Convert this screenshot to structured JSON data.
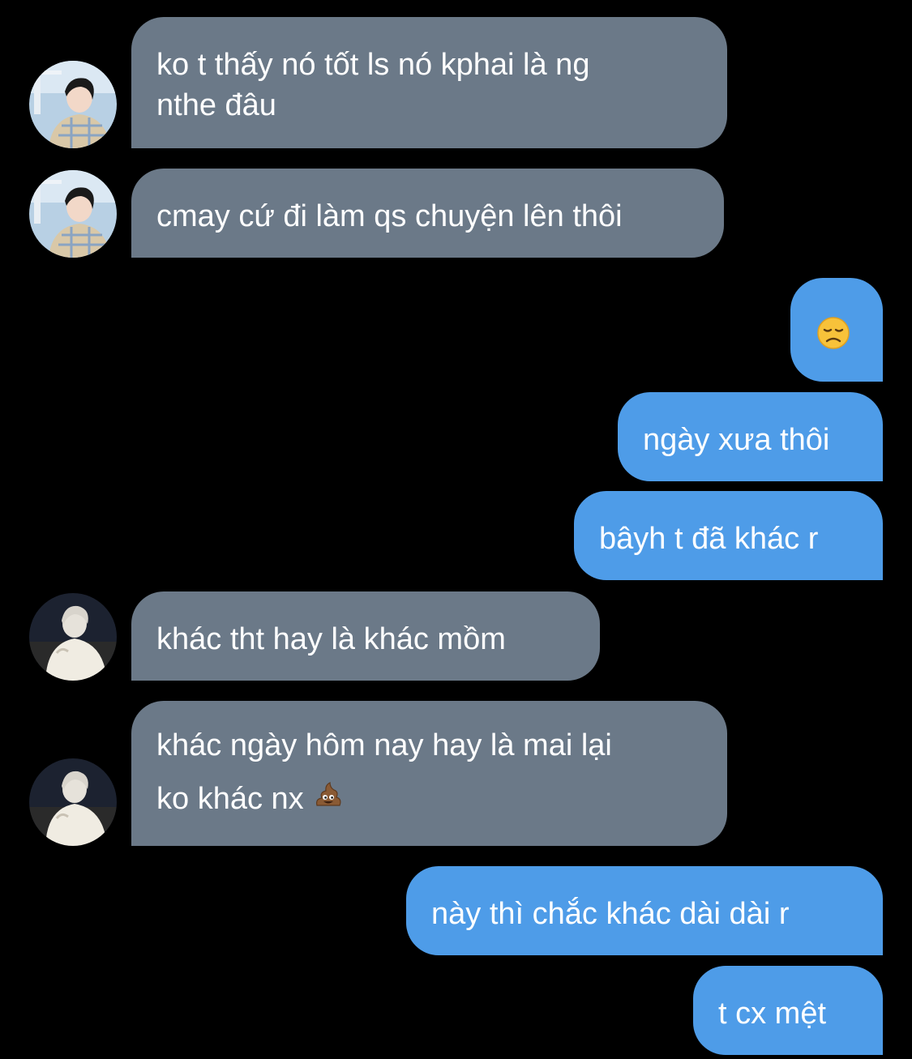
{
  "colors": {
    "background": "#000000",
    "incoming_bubble": "#6b7988",
    "outgoing_bubble": "#4e9ce8",
    "text": "#ffffff"
  },
  "messages": [
    {
      "direction": "incoming",
      "avatar": "avatar-photo-boy",
      "lines": [
        "ko t thấy nó tốt ls nó kphai là ng",
        "nthe đâu"
      ]
    },
    {
      "direction": "incoming",
      "avatar": "avatar-photo-boy",
      "lines": [
        "cmay cứ đi làm qs chuyện lên thôi"
      ]
    },
    {
      "direction": "outgoing",
      "emoji": "disappointed-face-emoji",
      "lines": []
    },
    {
      "direction": "outgoing",
      "lines": [
        "ngày xưa thôi"
      ]
    },
    {
      "direction": "outgoing",
      "lines": [
        "bâyh t đã khác r"
      ]
    },
    {
      "direction": "incoming",
      "avatar": "avatar-photo-figure",
      "lines": [
        "khác tht hay là khác mồm"
      ]
    },
    {
      "direction": "incoming",
      "avatar": "avatar-photo-figure",
      "lines": [
        "khác ngày hôm nay hay là mai lại",
        "ko khác nx"
      ],
      "trailing_emoji": "pile-of-poo-emoji"
    },
    {
      "direction": "outgoing",
      "lines": [
        "này thì chắc khác dài dài r"
      ]
    },
    {
      "direction": "outgoing",
      "lines": [
        "t cx mệt"
      ]
    }
  ]
}
